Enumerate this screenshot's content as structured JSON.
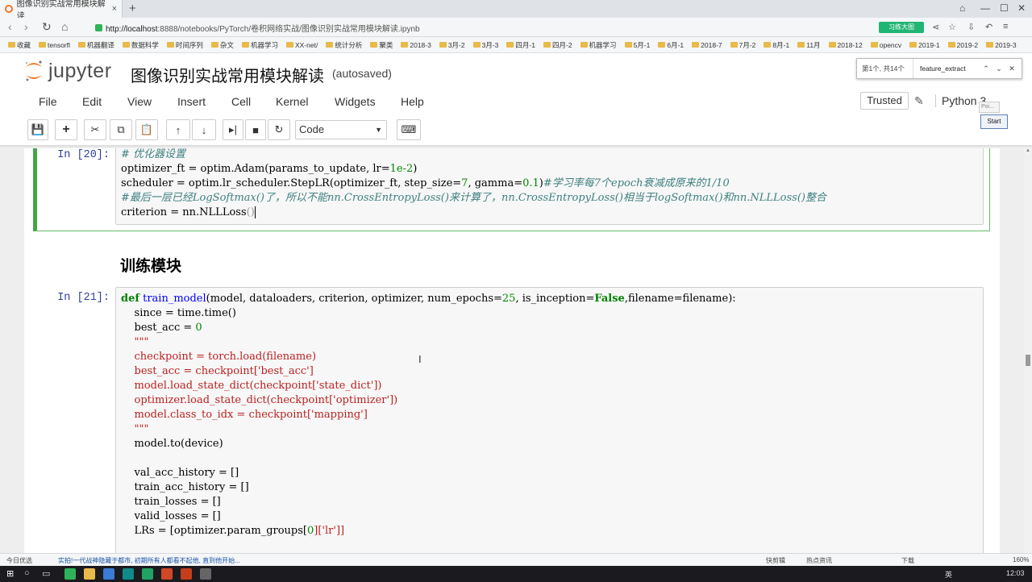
{
  "browser": {
    "tab_title": "图像识别实战常用模块解读",
    "tab_close": "×",
    "new_tab": "+",
    "url_host": "http://localhost",
    "url_rest": ":8888/notebooks/PyTorch/卷积网络实战/图像识别实战常用模块解读.ipynb",
    "ext_badge": "习练大图",
    "bookmarks": [
      "收藏",
      "tensorfl",
      "机器翻译",
      "数据科学",
      "时间序列",
      "杂文",
      "机器学习",
      "XX-net/",
      "统计分析",
      "聚类",
      "2018-3",
      "3月-2",
      "3月-3",
      "四月-1",
      "四月-2",
      "机器学习",
      "5月-1",
      "6月-1",
      "2018-7",
      "7月-2",
      "8月-1",
      "11月",
      "2018-12",
      "opencv",
      "2019-1",
      "2019-2",
      "2019-3"
    ]
  },
  "jupyter": {
    "logo_text": "jupyter",
    "notebook_title": "图像识别实战常用模块解读",
    "save_status": "(autosaved)",
    "menu": [
      "File",
      "Edit",
      "View",
      "Insert",
      "Cell",
      "Kernel",
      "Widgets",
      "Help"
    ],
    "trusted": "Trusted",
    "kernel": "Python 3",
    "cell_type": "Code",
    "find": {
      "count": "第1个, 共14个",
      "query": "feature_extract"
    },
    "popup_small": "Poi...",
    "popup_start": "Start"
  },
  "cells": {
    "cell20": {
      "prompt": "In [20]:",
      "lines": {
        "l1": "# 优化器设置",
        "l2a": "optimizer_ft = optim.Adam(params_to_update, lr=",
        "l2b": "1e-2",
        "l2c": ")",
        "l3a": "scheduler = optim.lr_scheduler.StepLR(optimizer_ft, step_size=",
        "l3b": "7",
        "l3c": ", gamma=",
        "l3d": "0.1",
        "l3e": ")",
        "l3f": "#学习率每7个epoch衰减成原来的1/10",
        "l4": "#最后一层已经LogSoftmax()了，所以不能nn.CrossEntropyLoss()来计算了，nn.CrossEntropyLoss()相当于logSoftmax()和nn.NLLLoss()整合",
        "l5a": "criterion = nn.NLLLoss",
        "l5b": "()"
      }
    },
    "heading": "训练模块",
    "cell21": {
      "prompt": "In [21]:",
      "lines": {
        "l1a": "def",
        "l1b": " ",
        "l1c": "train_model",
        "l1d": "(model, dataloaders, criterion, optimizer, num_epochs=",
        "l1e": "25",
        "l1f": ", is_inception=",
        "l1g": "False",
        "l1h": ",filename=filename):",
        "l2": "    since = time.time()",
        "l3a": "    best_acc = ",
        "l3b": "0",
        "l4": "    \"\"\"",
        "l5": "    checkpoint = torch.load(filename)",
        "l6": "    best_acc = checkpoint['best_acc']",
        "l7": "    model.load_state_dict(checkpoint['state_dict'])",
        "l8": "    optimizer.load_state_dict(checkpoint['optimizer'])",
        "l9": "    model.class_to_idx = checkpoint['mapping']",
        "l10": "    \"\"\"",
        "l11": "    model.to(device)",
        "l12": "    val_acc_history = []",
        "l13": "    train_acc_history = []",
        "l14": "    train_losses = []",
        "l15": "    valid_losses = []",
        "l16a": "    LRs = [optimizer.param_groups[",
        "l16b": "0",
        "l16c": "]['lr']]"
      }
    }
  },
  "status": {
    "left1": "今日优选",
    "left2": "实拍!一代战神隐藏于都市, 初期所有人都看不起他, 直到他开始...",
    "right1": "快剪辑",
    "right2": "热点资讯",
    "right3": "下载",
    "zoom": "160%"
  },
  "taskbar": {
    "ime": "英",
    "clock": "12:03"
  },
  "colors": {
    "jupyter_orange": "#f37726",
    "selected_cell": "#42a547",
    "prompt_blue": "#303f9f"
  }
}
